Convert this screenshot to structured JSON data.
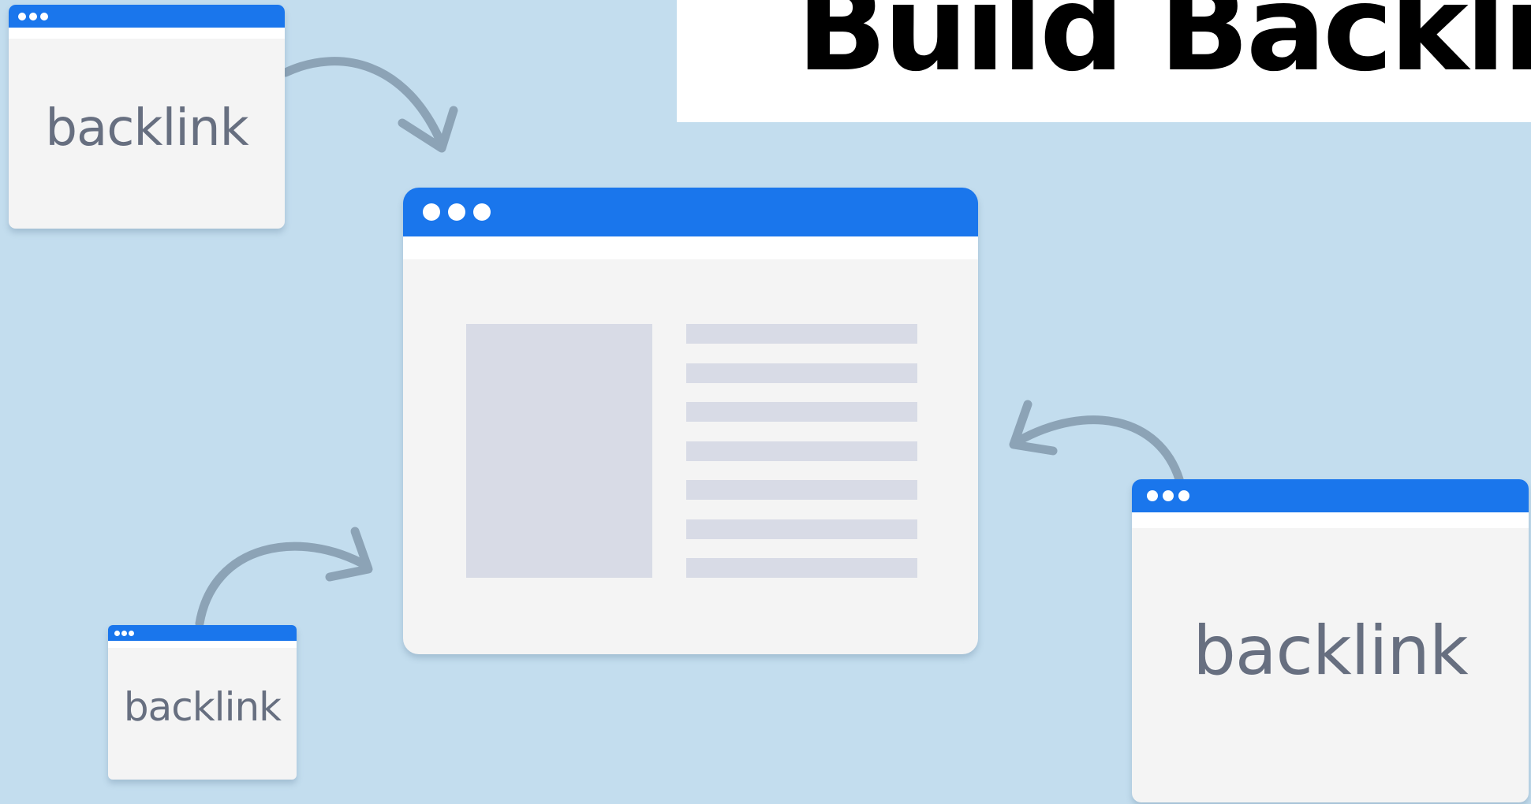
{
  "title": {
    "text": "Build Backlinks"
  },
  "backlink_windows": {
    "top_left": {
      "label": "backlink"
    },
    "bottom_left": {
      "label": "backlink"
    },
    "right": {
      "label": "backlink"
    }
  },
  "colors": {
    "background": "#c3ddee",
    "titlebar": "#1a76ec",
    "window_body": "#f4f4f4",
    "placeholder": "#d8dbe6",
    "arrow": "#8ca3b6",
    "label_text": "#676f80",
    "banner": "#ffffff"
  }
}
